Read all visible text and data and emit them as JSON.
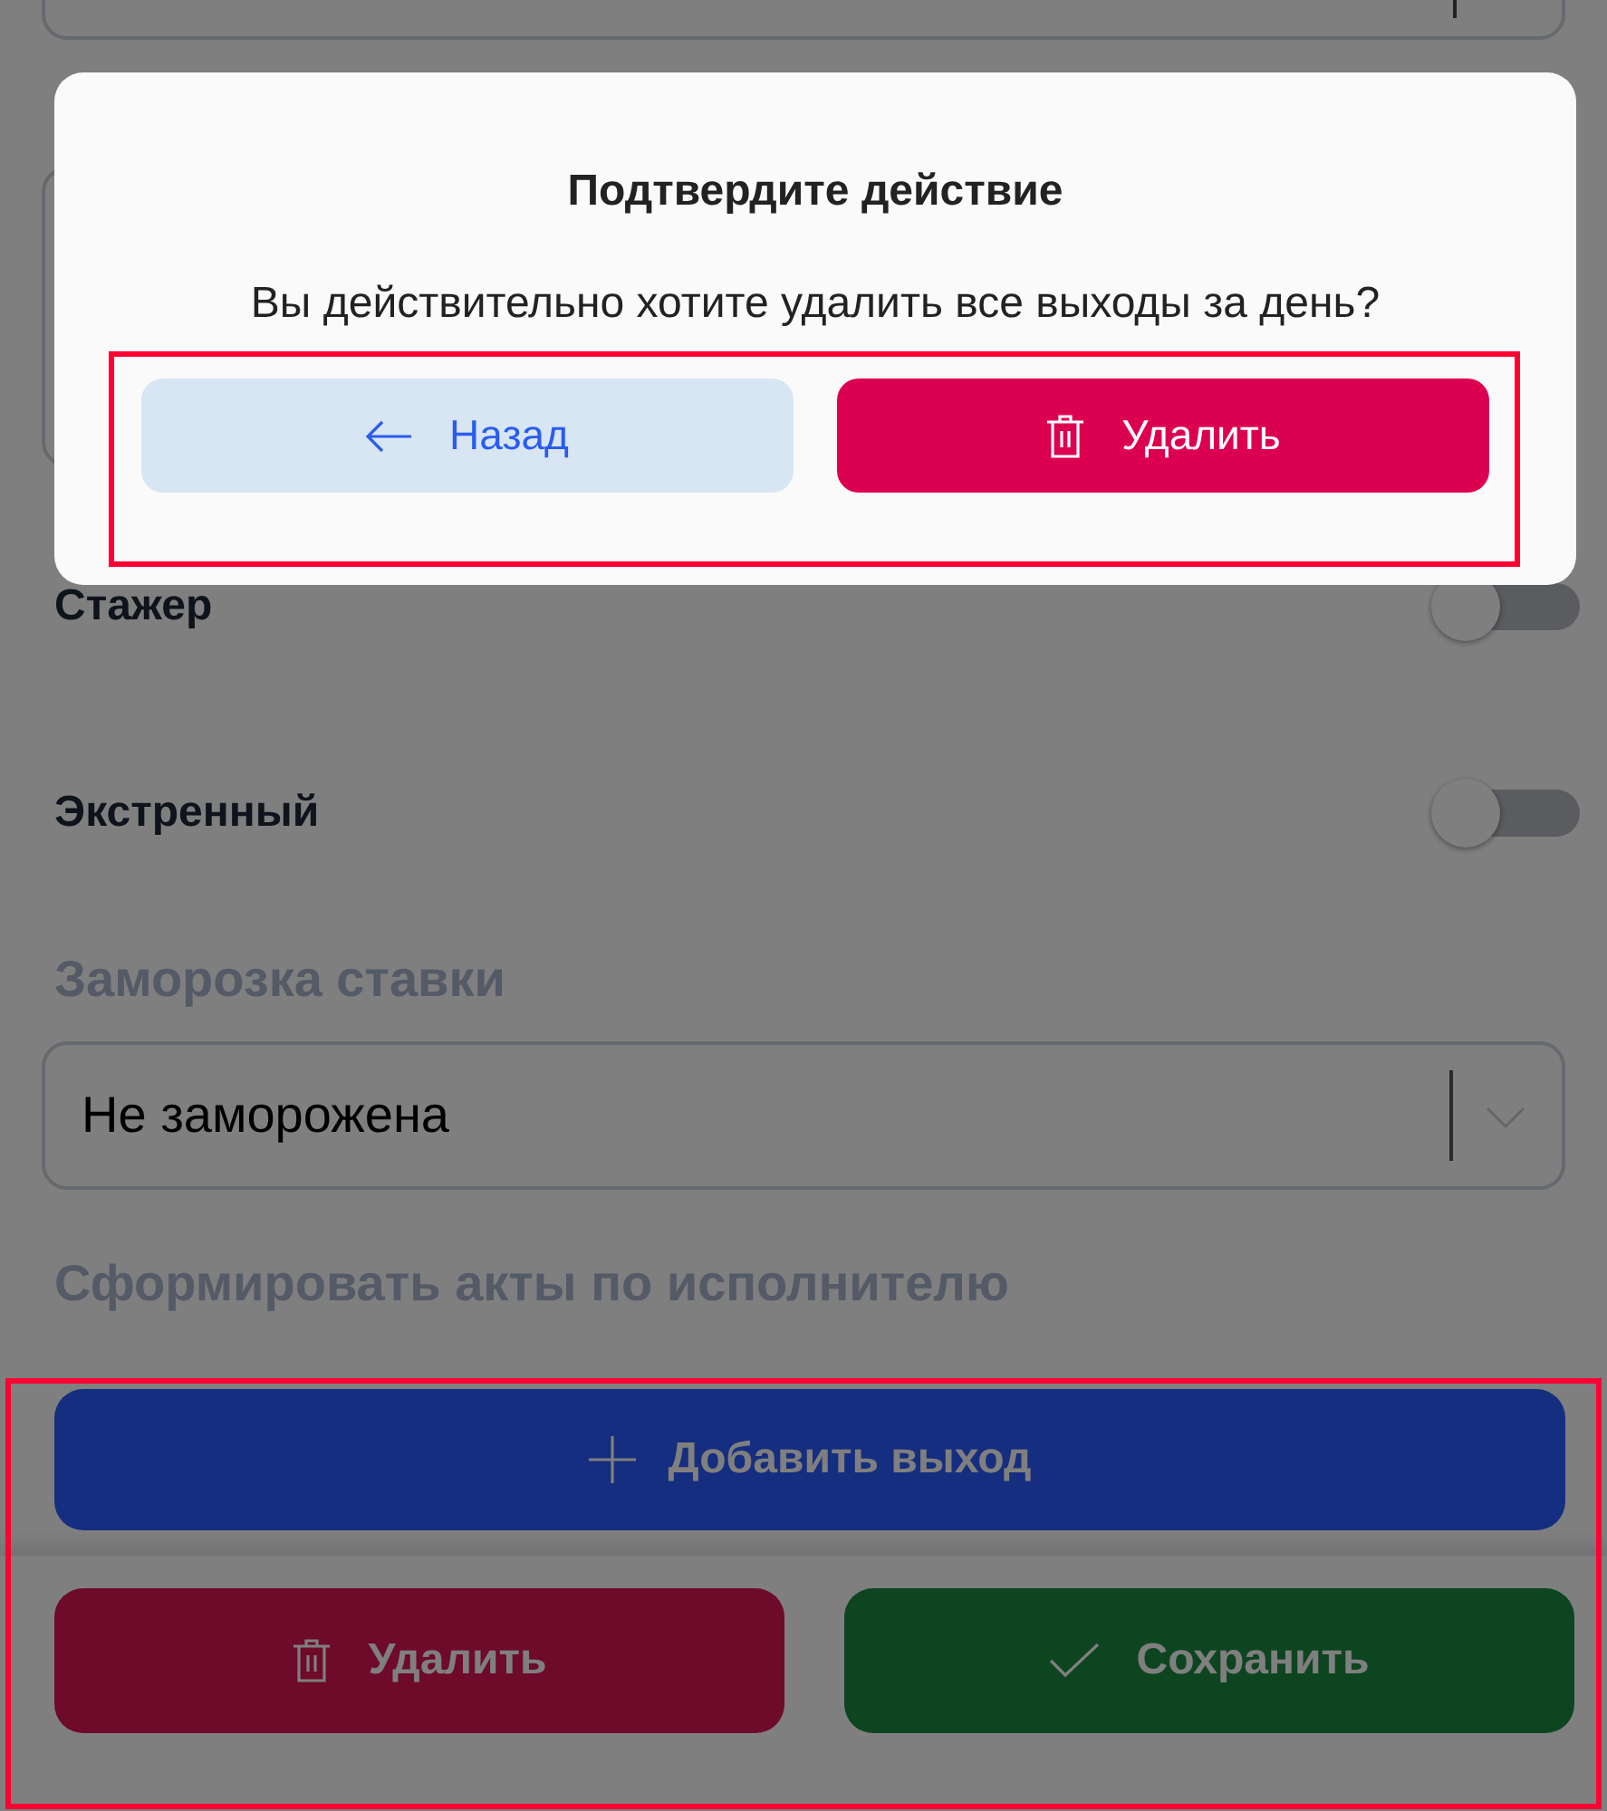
{
  "form": {
    "toggles": [
      {
        "label": "Стажер",
        "on": false
      },
      {
        "label": "Экстренный",
        "on": false
      }
    ],
    "freeze": {
      "heading": "Заморозка ставки",
      "value": "Не заморожена"
    },
    "acts_heading": "Сформировать акты по исполнителю"
  },
  "actions": {
    "add_button": "Добавить выход",
    "highlighted": true,
    "buttons": [
      {
        "kind": "delete",
        "label": "Удалить"
      },
      {
        "kind": "save",
        "label": "Сохранить"
      }
    ]
  },
  "dialog": {
    "title": "Подтвердите действие",
    "message": "Вы действительно хотите удалить все выходы за день?",
    "highlighted": true,
    "buttons": [
      {
        "kind": "back",
        "label": "Назад"
      },
      {
        "kind": "delete",
        "label": "Удалить"
      }
    ]
  }
}
